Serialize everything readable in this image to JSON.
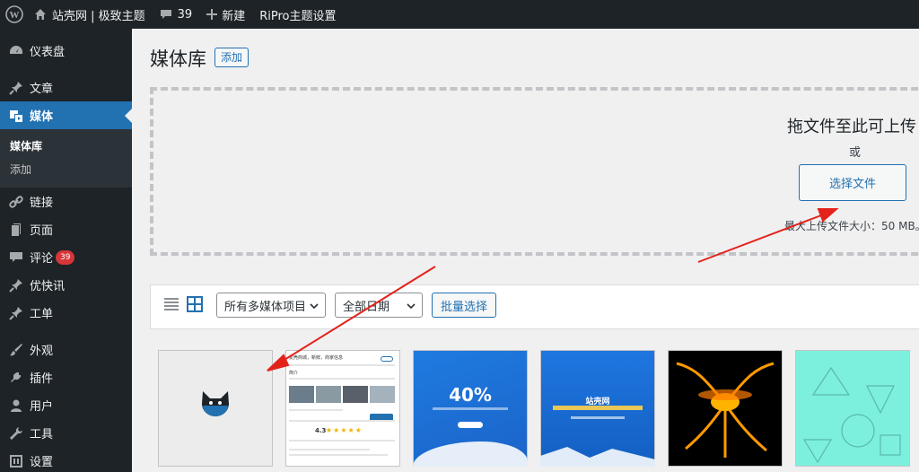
{
  "adminbar": {
    "site_name": "站壳网 | 极致主题",
    "comments_count": "39",
    "new_label": "新建",
    "theme_settings": "RiPro主题设置"
  },
  "sidebar": {
    "items": [
      {
        "label": "仪表盘",
        "icon": "dashboard-icon"
      },
      {
        "label": "文章",
        "icon": "pushpin-icon"
      },
      {
        "label": "媒体",
        "icon": "media-icon",
        "current": true
      },
      {
        "label": "链接",
        "icon": "link-icon"
      },
      {
        "label": "页面",
        "icon": "page-icon"
      },
      {
        "label": "评论",
        "icon": "comment-icon",
        "badge": "39"
      },
      {
        "label": "优快讯",
        "icon": "pushpin-icon"
      },
      {
        "label": "工单",
        "icon": "pushpin-icon"
      },
      {
        "label": "外观",
        "icon": "appearance-icon"
      },
      {
        "label": "插件",
        "icon": "plugin-icon"
      },
      {
        "label": "用户",
        "icon": "user-icon"
      },
      {
        "label": "工具",
        "icon": "tools-icon"
      },
      {
        "label": "设置",
        "icon": "settings-icon"
      }
    ],
    "submenu": {
      "library": "媒体库",
      "add": "添加"
    }
  },
  "main": {
    "title": "媒体库",
    "add_button": "添加",
    "dropzone": {
      "title": "拖文件至此可上传",
      "or": "或",
      "select_button": "选择文件",
      "max_size": "最大上传文件大小：50 MB。"
    },
    "toolbar": {
      "type_filter": "所有多媒体项目",
      "date_filter": "全部日期",
      "bulk_select": "批量选择"
    },
    "thumbnails": {
      "doc_header": "爱壳商城，新鲜，商家信息",
      "doc_tab": "简介",
      "doc_rating": "4.3",
      "doc_stars": "★★★★★",
      "promo_percent": "40%",
      "brand_name": "站壳网"
    }
  },
  "colors": {
    "admin_dark": "#1d2327",
    "accent": "#2271b1",
    "badge": "#d63638",
    "background": "#f0f0f1"
  }
}
